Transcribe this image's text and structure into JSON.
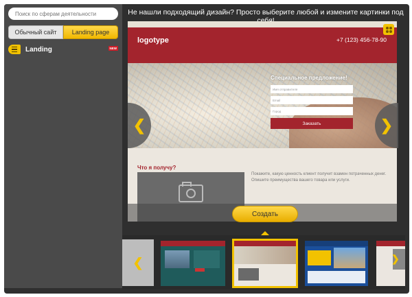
{
  "sidebar": {
    "search_placeholder": "Поиск по сферам деятельности",
    "toggle": {
      "off_label": "Обычный сайт",
      "on_label": "Landing page"
    },
    "category": {
      "label": "Landing",
      "badge": "NEW"
    }
  },
  "header": {
    "headline": "Не нашли подходящий дизайн? Просто выберите любой и измените картинки под себя!"
  },
  "preview": {
    "logo": "logotype",
    "phone": "+7 (123) 456-78-90",
    "form": {
      "title": "Специальное предложение!",
      "field_name_placeholder": "Имя отправителя",
      "field_email_placeholder": "Email",
      "field_phone_placeholder": "Город",
      "submit_label": "Заказать"
    },
    "section_title": "Что я получу?",
    "section_text": "Покажите, какую ценность клиент получит взамен потраченных денег. Опишите преимущества вашего товара или услуги.",
    "section2_title": "Что я получу?"
  },
  "create_button_label": "Создать",
  "arrows": {
    "left": "❮",
    "right": "❯"
  },
  "carousel": {
    "left_arrow": "❮",
    "right_arrow": "❯"
  },
  "colors": {
    "accent": "#f2c200",
    "brand_red": "#a3242d",
    "sidebar_bg": "#4a4a4a",
    "frame_bg": "#2f2f2f"
  }
}
